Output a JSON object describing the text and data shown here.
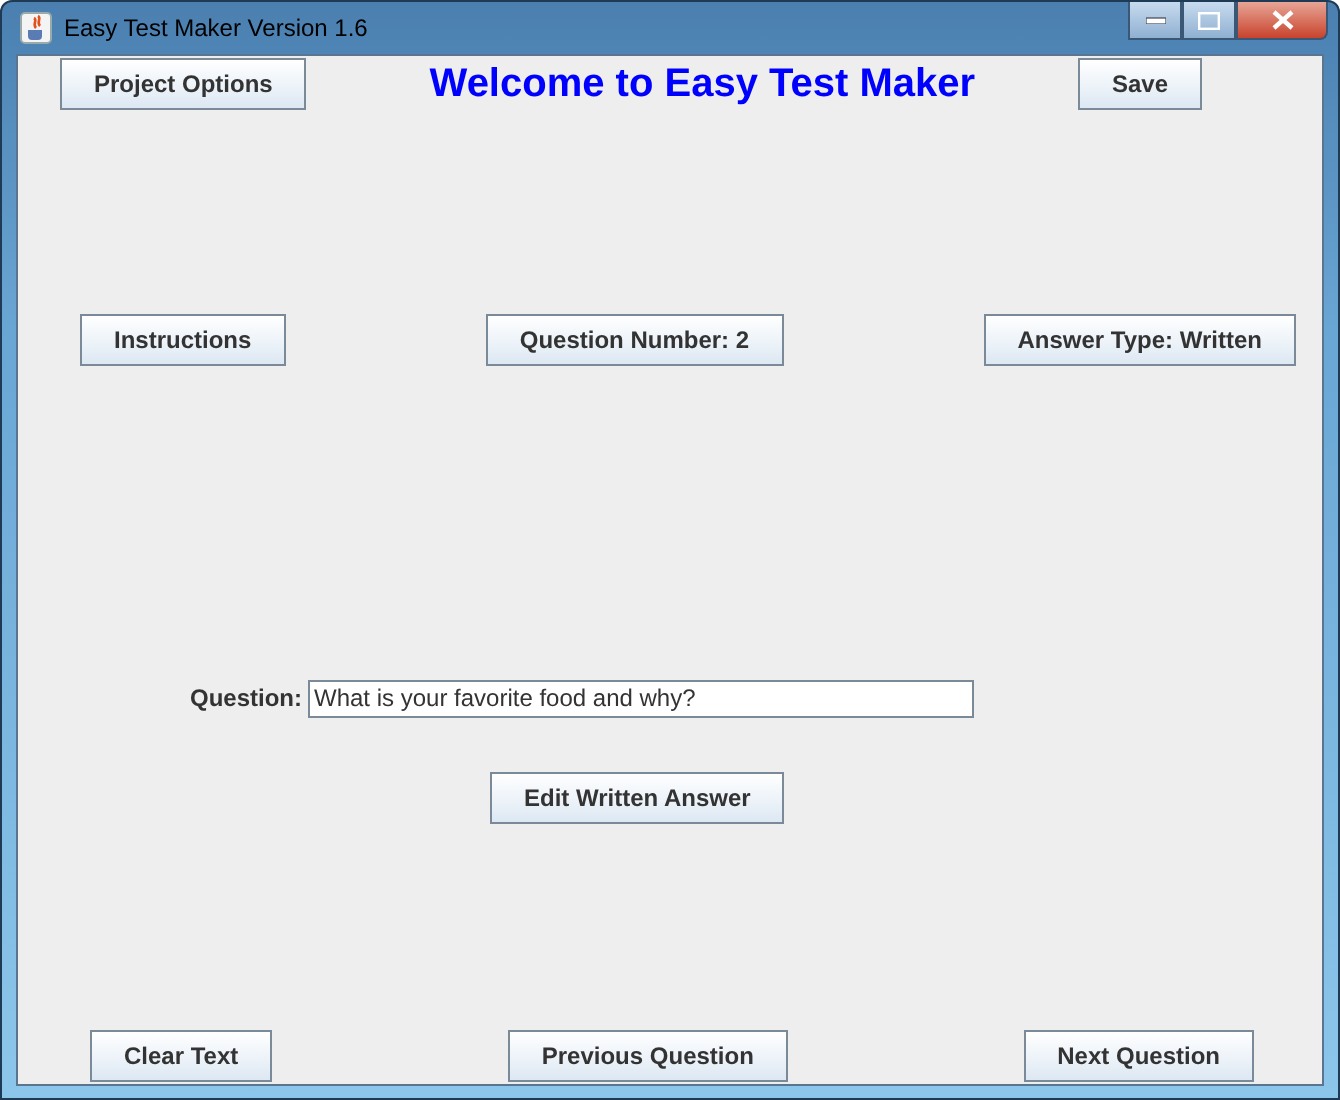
{
  "window": {
    "title": "Easy Test Maker Version 1.6"
  },
  "header": {
    "left_button": "Project Options",
    "heading": "Welcome to Easy Test Maker",
    "right_button": "Save"
  },
  "middle_buttons": [
    "Instructions",
    "Question Number: 2",
    "Answer Type: Written"
  ],
  "question": {
    "label": "Question:",
    "value": "What is your favorite food and why?"
  },
  "edit_button": "Edit Written Answer",
  "bottom_buttons": [
    "Clear Text",
    "Previous Question",
    "Next Question"
  ]
}
